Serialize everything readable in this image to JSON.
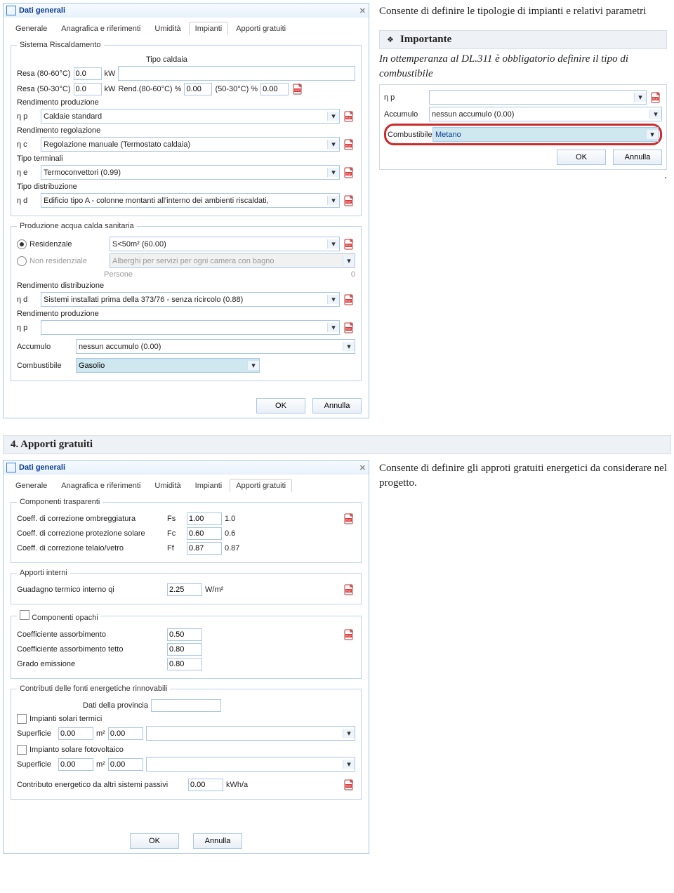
{
  "win1": {
    "title": "Dati generali",
    "tabs": [
      "Generale",
      "Anagrafica e riferimenti",
      "Umidità",
      "Impianti",
      "Apporti gratuiti"
    ],
    "active_tab": 3,
    "sistema": {
      "legend": "Sistema Riscaldamento",
      "tipo_caldaia_label": "Tipo caldaia",
      "resa80_label": "Resa (80-60°C)",
      "resa80_value": "0.0",
      "kw": "kW",
      "tipo_caldaia_value": "",
      "resa50_label": "Resa (50-30°C)",
      "resa50_value": "0.0",
      "rend80_label": "Rend.(80-60°C) %",
      "rend80_value": "0.00",
      "rend50_label": "(50-30°C) %",
      "rend50_value": "0.00",
      "rend_prod_label": "Rendimento produzione",
      "np_label": "η p",
      "np_value": "Caldaie standard",
      "rend_reg_label": "Rendimento regolazione",
      "nc_label": "η c",
      "nc_value": "Regolazione manuale (Termostato caldaia)",
      "tipo_term_label": "Tipo terminali",
      "ne_label": "η e",
      "ne_value": "Termoconvettori (0.99)",
      "tipo_distr_label": "Tipo distribuzione",
      "nd_label": "η d",
      "nd_value": "Edificio tipo A - colonne montanti all'interno dei ambienti riscaldati,"
    },
    "acqua": {
      "legend": "Produzione acqua calda sanitaria",
      "res_label": "Residenzale",
      "res_value": "S<50m² (60.00)",
      "nonres_label": "Non residenziale",
      "nonres_value": "Alberghi per servizi per ogni camera con bagno",
      "persone_label": "Persone",
      "persone_value": "0",
      "rend_distr_label": "Rendimento distribuzione",
      "nd_label": "η d",
      "nd_value": "Sistemi installati prima della 373/76 - senza ricircolo (0.88)",
      "rend_prod_label": "Rendimento produzione",
      "np_label": "η p",
      "np_value": "",
      "accum_label": "Accumulo",
      "accum_value": "nessun accumulo (0.00)",
      "comb_label": "Combustibile",
      "comb_value": "Gasolio"
    },
    "ok": "OK",
    "cancel": "Annulla"
  },
  "text1": {
    "main": "Consente di definire le tipologie di impianti e relativi parametri",
    "callout_title": "Importante",
    "callout_body": "In ottemperanza al DL.311 è obbligatorio definire il tipo di combustibile",
    "inset": {
      "np_label": "η p",
      "np_value": "",
      "accum_label": "Accumulo",
      "accum_value": "nessun accumulo (0.00)",
      "comb_label": "Combustibile",
      "comb_value": "Metano",
      "ok": "OK",
      "cancel": "Annulla"
    },
    "dot": "."
  },
  "sectionhead": "4.  Apporti gratuiti",
  "win2": {
    "title": "Dati generali",
    "tabs": [
      "Generale",
      "Anagrafica e riferimenti",
      "Umidità",
      "Impianti",
      "Apporti gratuiti"
    ],
    "active_tab": 4,
    "trasp": {
      "legend": "Componenti trasparenti",
      "r1_label": "Coeff. di correzione ombreggiatura",
      "r1_sym": "Fs",
      "r1_val": "1.00",
      "r1_note": "1.0",
      "r2_label": "Coeff. di correzione protezione solare",
      "r2_sym": "Fc",
      "r2_val": "0.60",
      "r2_note": "0.6",
      "r3_label": "Coeff. di correzione telaio/vetro",
      "r3_sym": "Ff",
      "r3_val": "0.87",
      "r3_note": "0.87"
    },
    "interni": {
      "legend": "Apporti interni",
      "label": "Guadagno termico interno qi",
      "val": "2.25",
      "unit": "W/m²"
    },
    "opachi": {
      "legend": "Componenti opachi",
      "r1": "Coefficiente assorbimento",
      "r1v": "0.50",
      "r2": "Coefficiente assorbimento tetto",
      "r2v": "0.80",
      "r3": "Grado emissione",
      "r3v": "0.80"
    },
    "rinn": {
      "legend": "Contributi delle fonti energetiche rinnovabili",
      "dati_prov": "Dati della provincia",
      "term_label": "Impianti solari termici",
      "sup_label": "Superficie",
      "sup_val": "0.00",
      "m2": "m²",
      "val2": "0.00",
      "foto_label": "Impianto solare fotovoltaico",
      "sup2_val": "0.00",
      "val3": "0.00",
      "contrib_label": "Contributo energetico da altri sistemi passivi",
      "contrib_val": "0.00",
      "contrib_unit": "kWh/a"
    },
    "ok": "OK",
    "cancel": "Annulla"
  },
  "text2": "Consente di definire gli approti gratuiti energetici da considerare nel progetto."
}
